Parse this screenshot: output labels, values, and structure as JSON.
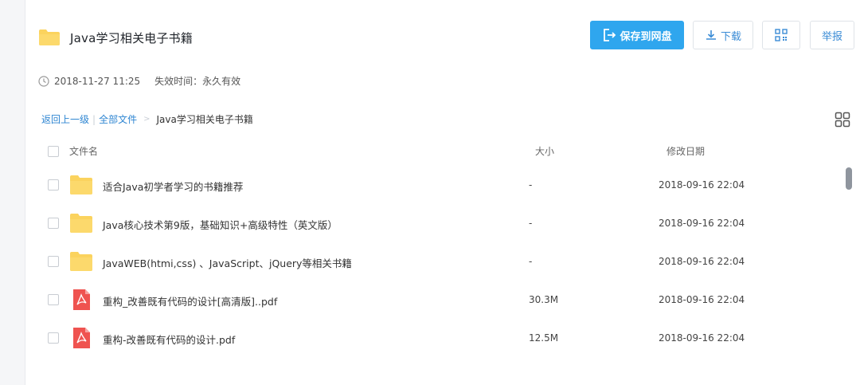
{
  "share": {
    "title": "Java学习相关电子书籍",
    "created": "2018-11-27 11:25",
    "expire_label": "失效时间：",
    "expire_value": "永久有效"
  },
  "actions": {
    "save": "保存到网盘",
    "download": "下载",
    "report": "举报"
  },
  "breadcrumb": {
    "back": "返回上一级",
    "sep": "|",
    "all_files": "全部文件",
    "arrow": ">",
    "current": "Java学习相关电子书籍"
  },
  "table": {
    "headers": {
      "name": "文件名",
      "size": "大小",
      "modified": "修改日期"
    },
    "rows": [
      {
        "icon": "folder-icon",
        "name": "适合Java初学者学习的书籍推荐",
        "size": "-",
        "date": "2018-09-16 22:04"
      },
      {
        "icon": "folder-icon",
        "name": "Java核心技术第9版，基础知识+高级特性（英文版）",
        "size": "-",
        "date": "2018-09-16 22:04"
      },
      {
        "icon": "folder-icon",
        "name": "JavaWEB(htmi,css) 、JavaScript、jQuery等相关书籍",
        "size": "-",
        "date": "2018-09-16 22:04"
      },
      {
        "icon": "pdf-icon",
        "name": "重构_改善既有代码的设计[高清版]..pdf",
        "size": "30.3M",
        "date": "2018-09-16 22:04"
      },
      {
        "icon": "pdf-icon",
        "name": "重构-改善既有代码的设计.pdf",
        "size": "12.5M",
        "date": "2018-09-16 22:04"
      }
    ]
  },
  "colors": {
    "primary": "#2fa6ee",
    "link": "#2f86d2",
    "folder": "#fbd35e",
    "pdf": "#ef5350"
  }
}
